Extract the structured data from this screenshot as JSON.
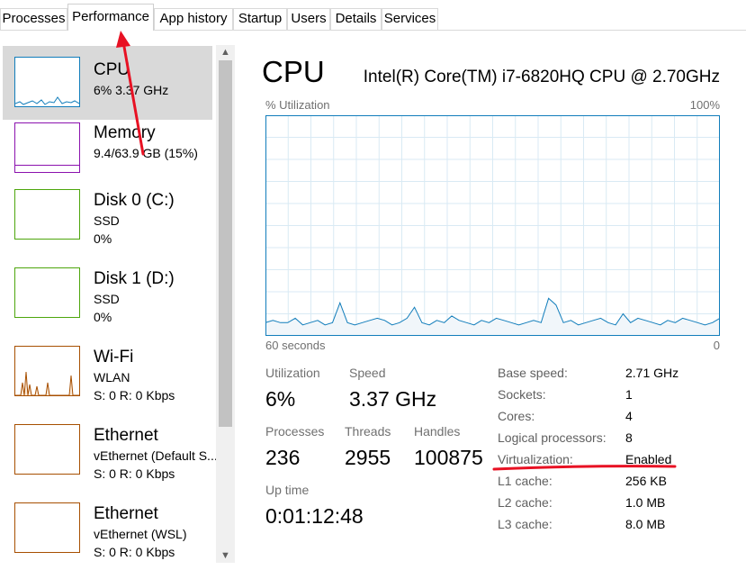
{
  "tabs": [
    "Processes",
    "Performance",
    "App history",
    "Startup",
    "Users",
    "Details",
    "Services"
  ],
  "sidebar": {
    "items": [
      {
        "name": "CPU",
        "line1": "6%  3.37 GHz",
        "line2": "",
        "color": "#117dbb"
      },
      {
        "name": "Memory",
        "line1": "9.4/63.9 GB (15%)",
        "line2": "",
        "color": "#8b12ae"
      },
      {
        "name": "Disk 0 (C:)",
        "line1": "SSD",
        "line2": "0%",
        "color": "#4da60c"
      },
      {
        "name": "Disk 1 (D:)",
        "line1": "SSD",
        "line2": "0%",
        "color": "#4da60c"
      },
      {
        "name": "Wi-Fi",
        "line1": "WLAN",
        "line2": "S: 0 R: 0 Kbps",
        "color": "#a74f01"
      },
      {
        "name": "Ethernet",
        "line1": "vEthernet (Default S...",
        "line2": "S: 0 R: 0 Kbps",
        "color": "#a74f01"
      },
      {
        "name": "Ethernet",
        "line1": "vEthernet (WSL)",
        "line2": "S: 0 R: 0 Kbps",
        "color": "#a74f01"
      }
    ]
  },
  "main": {
    "title": "CPU",
    "cpu_model": "Intel(R) Core(TM) i7-6820HQ CPU @ 2.70GHz",
    "graph": {
      "ylabel": "% Utilization",
      "ymax_label": "100%",
      "xlabel": "60 seconds",
      "xmin_label": "0",
      "color": "#117dbb",
      "fill": "#f1f6fa",
      "grid": "#d9eaf4"
    },
    "stats": {
      "utilization_label": "Utilization",
      "utilization": "6%",
      "speed_label": "Speed",
      "speed": "3.37 GHz",
      "processes_label": "Processes",
      "processes": "236",
      "threads_label": "Threads",
      "threads": "2955",
      "handles_label": "Handles",
      "handles": "100875",
      "uptime_label": "Up time",
      "uptime": "0:01:12:48"
    },
    "details": [
      {
        "key": "Base speed:",
        "value": "2.71 GHz"
      },
      {
        "key": "Sockets:",
        "value": "1"
      },
      {
        "key": "Cores:",
        "value": "4"
      },
      {
        "key": "Logical processors:",
        "value": "8"
      },
      {
        "key": "Virtualization:",
        "value": "Enabled"
      },
      {
        "key": "L1 cache:",
        "value": "256 KB"
      },
      {
        "key": "L2 cache:",
        "value": "1.0 MB"
      },
      {
        "key": "L3 cache:",
        "value": "8.0 MB"
      }
    ]
  },
  "chart_data": {
    "type": "area",
    "ylabel": "% Utilization",
    "ylim": [
      0,
      100
    ],
    "xlabel": "60 seconds",
    "x": [
      60,
      59,
      58,
      57,
      56,
      55,
      54,
      53,
      52,
      51,
      50,
      49,
      48,
      47,
      46,
      45,
      44,
      43,
      42,
      41,
      40,
      39,
      38,
      37,
      36,
      35,
      34,
      33,
      32,
      31,
      30,
      29,
      28,
      27,
      26,
      25,
      24,
      23,
      22,
      21,
      20,
      19,
      18,
      17,
      16,
      15,
      14,
      13,
      13,
      12,
      11,
      10,
      9,
      8,
      7,
      6,
      5,
      4,
      3,
      2,
      1,
      0
    ],
    "series": [
      {
        "values": [
          6,
          7,
          6,
          6,
          8,
          5,
          6,
          7,
          5,
          6,
          15,
          6,
          5,
          6,
          7,
          8,
          7,
          5,
          6,
          8,
          13,
          6,
          5,
          7,
          6,
          9,
          7,
          6,
          5,
          7,
          6,
          8,
          7,
          6,
          5,
          6,
          7,
          6,
          17,
          14,
          6,
          7,
          5,
          6,
          7,
          8,
          6,
          5,
          10,
          6,
          8,
          7,
          6,
          5,
          7,
          6,
          8,
          7,
          6,
          5,
          6,
          8
        ]
      }
    ],
    "grid": true
  },
  "annotations": {
    "arrow_color": "#e81123",
    "underline_color": "#e81123"
  }
}
